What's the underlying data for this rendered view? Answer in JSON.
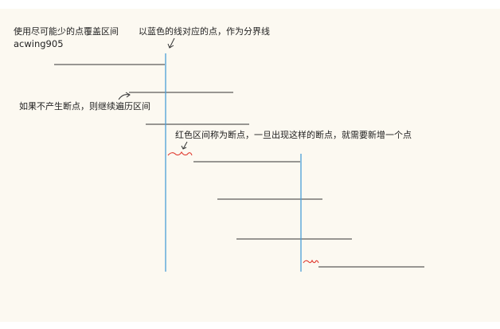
{
  "notes": {
    "title_line1": "使用尽可能少的点覆盖区间",
    "title_line2": "acwing905",
    "blue_line_note": "以蓝色的线对应的点，作为分界线",
    "continue_note": "如果不产生断点，则继续遍历区间",
    "red_break_note": "红色区间称为断点，一旦出现这样的断点，就需要新增一个点"
  },
  "colors": {
    "background": "#fcf9f1",
    "interval": "#333333",
    "divider": "#4a9ed8",
    "breakpoint": "#e03a2f",
    "text": "#222222"
  }
}
